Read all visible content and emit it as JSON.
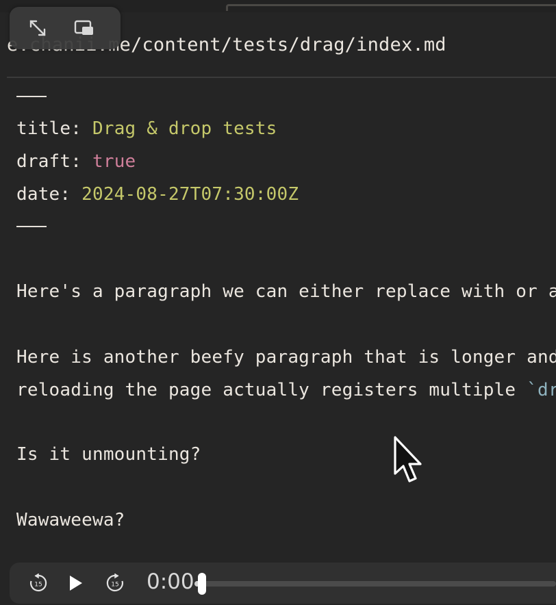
{
  "editor": {
    "file_path": "e.chanii.me/content/tests/drag/index.md",
    "frontmatter_rule_top": "---",
    "frontmatter": [
      {
        "key": "title: ",
        "value": "Drag & drop tests",
        "type": "string"
      },
      {
        "key": "draft: ",
        "value": "true",
        "type": "bool"
      },
      {
        "key": "date: ",
        "value": "2024-08-27T07:30:00Z",
        "type": "date"
      }
    ],
    "frontmatter_rule_bottom": "---",
    "paragraph1": "Here's a paragraph we can either replace with or appe",
    "paragraph2_line1": "Here is another beefy paragraph that is longer and we",
    "paragraph2_line2_text": "reloading the page actually registers multiple ",
    "paragraph2_line2_code": "`drag",
    "line_unmounting": "Is it unmounting?",
    "line_wawa": "Wawaweewa?"
  },
  "pip_controls": {
    "expand_icon": "expand-arrows-icon",
    "pip_icon": "picture-in-picture-icon"
  },
  "media": {
    "rewind_label": "15",
    "forward_label": "15",
    "play_icon": "play-icon",
    "time": "0:00",
    "progress_fraction": 0.02
  },
  "colors": {
    "background": "#252525",
    "text": "#ebe6df",
    "string_value": "#c5c86a",
    "bool_value": "#cf7f9a",
    "code_span": "#8fb3bf"
  }
}
